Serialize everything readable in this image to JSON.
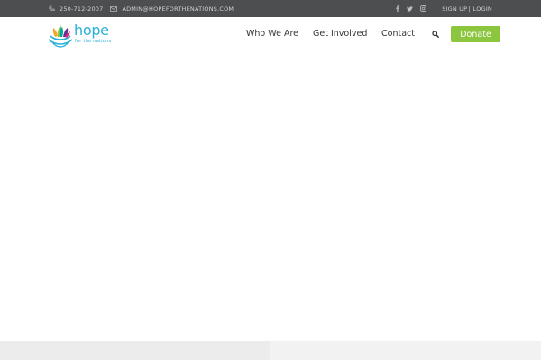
{
  "topbar": {
    "phone": "250-712-2007",
    "email": "ADMIN@HOPEFORTHENATIONS.COM",
    "social": [
      "facebook-icon",
      "twitter-icon",
      "instagram-icon"
    ],
    "sign_up": "SIGN UP",
    "separator": "|",
    "login": "LOGIN",
    "background_color": "#4d4e50"
  },
  "header": {
    "logo": {
      "word": "hope",
      "tagline": "for the nations",
      "color": "#2bb1d9"
    },
    "nav": [
      "Who We Are",
      "Get Involved",
      "Contact"
    ],
    "search_icon": "search-icon",
    "donate_label": "Donate",
    "donate_color": "#8cc63f"
  }
}
